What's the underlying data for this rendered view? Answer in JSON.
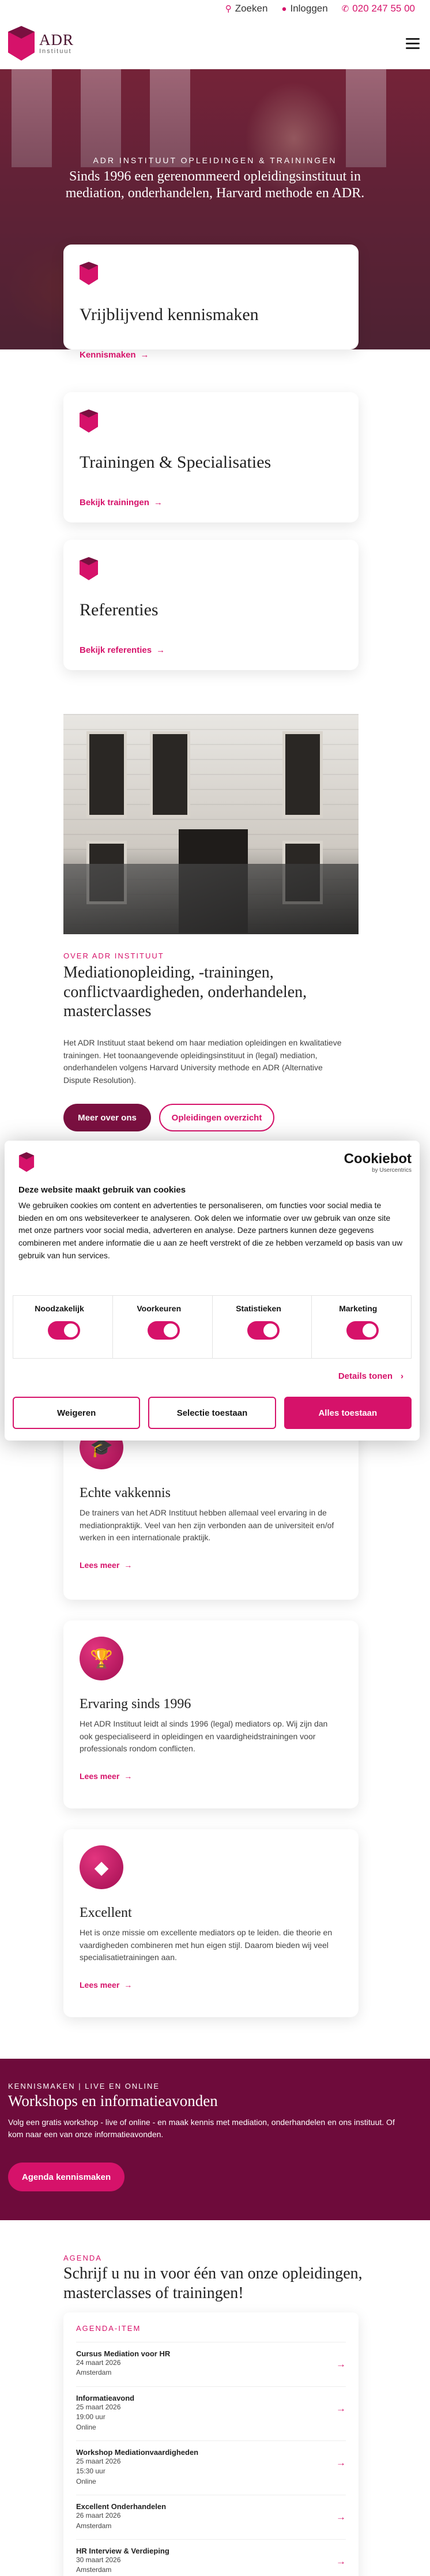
{
  "topbar": {
    "search": "Zoeken",
    "login": "Inloggen",
    "phone": "020 247 55 00"
  },
  "logo": {
    "name": "ADR",
    "sub": "Instituut"
  },
  "hero": {
    "kicker": "ADR INSTITUUT OPLEIDINGEN & TRAININGEN",
    "title": "Sinds 1996 een gerenommeerd opleidingsinstituut in mediation, onderhandelen, Harvard methode en ADR."
  },
  "cards": [
    {
      "title": "Vrijblijvend kennismaken",
      "link": "Kennismaken"
    },
    {
      "title": "Trainingen & Specialisaties",
      "link": "Bekijk trainingen"
    },
    {
      "title": "Referenties",
      "link": "Bekijk referenties"
    }
  ],
  "about": {
    "kicker": "OVER ADR INSTITUUT",
    "title": "Mediationopleiding, -trainingen, conflictvaardigheden, onderhandelen, masterclasses",
    "text": "Het ADR Instituut staat bekend om haar mediation opleidingen en kwalitatieve trainingen. Het toonaangevende opleidingsinstituut in (legal) mediation, onderhandelen volgens Harvard University methode en ADR (Alternative Dispute Resolution).",
    "btn_primary": "Meer over ons",
    "btn_outline": "Opleidingen overzicht"
  },
  "cookie": {
    "brand": "Cookiebot",
    "brand_sub": "by Usercentrics",
    "title": "Deze website maakt gebruik van cookies",
    "text": "We gebruiken cookies om content en advertenties te personaliseren, om functies voor social media te bieden en om ons websiteverkeer te analyseren. Ook delen we informatie over uw gebruik van onze site met onze partners voor social media, adverteren en analyse. Deze partners kunnen deze gegevens combineren met andere informatie die u aan ze heeft verstrekt of die ze hebben verzameld op basis van uw gebruik van hun services.",
    "toggles": [
      "Noodzakelijk",
      "Voorkeuren",
      "Statistieken",
      "Marketing"
    ],
    "details": "Details tonen",
    "btn_deny": "Weigeren",
    "btn_selection": "Selectie toestaan",
    "btn_all": "Alles toestaan"
  },
  "features": [
    {
      "icon": "graduation-cap-icon",
      "title": "Echte vakkennis",
      "text": "De trainers van het ADR Instituut hebben allemaal veel ervaring in de mediationpraktijk. Veel van hen zijn verbonden aan de universiteit en/of werken in een internationale praktijk.",
      "link": "Lees meer"
    },
    {
      "icon": "trophy-icon",
      "title": "Ervaring sinds 1996",
      "text": "Het ADR Instituut leidt al sinds 1996 (legal) mediators op. Wij zijn dan ook gespecialiseerd in opleidingen en vaardigheidstrainingen voor professionals rondom conflicten.",
      "link": "Lees meer"
    },
    {
      "icon": "diamond-icon",
      "title": "Excellent",
      "text": "Het is onze missie om excellente mediators op te leiden. die theorie en vaardigheden combineren met hun eigen stijl. Daarom bieden wij veel specialisatietrainingen aan.",
      "link": "Lees meer"
    }
  ],
  "workshops": {
    "kicker": "KENNISMAKEN | LIVE EN ONLINE",
    "title": "Workshops en informatieavonden",
    "text": "Volg een gratis workshop - live of online - en maak kennis met mediation, onderhandelen en ons instituut. Of kom naar een van onze informatieavonden.",
    "button": "Agenda kennismaken"
  },
  "agenda": {
    "kicker": "AGENDA",
    "title": "Schrijf u nu in voor één van onze opleidingen, masterclasses of trainingen!",
    "list_header": "AGENDA-ITEM",
    "items": [
      {
        "title": "Cursus Mediation voor HR",
        "date": "24 maart 2026",
        "place": "Amsterdam",
        "time": ""
      },
      {
        "title": "Informatieavond",
        "date": "25 maart 2026",
        "time": "19:00 uur",
        "place": "Online"
      },
      {
        "title": "Workshop Mediationvaardigheden",
        "date": "25 maart 2026",
        "time": "15:30 uur",
        "place": "Online"
      },
      {
        "title": "Excellent Onderhandelen",
        "date": "26 maart 2026",
        "place": "Amsterdam",
        "time": ""
      },
      {
        "title": "HR Interview & Verdieping",
        "date": "30 maart 2026",
        "place": "Amsterdam",
        "time": ""
      }
    ]
  },
  "colors": {
    "accent": "#d6126a",
    "dark": "#6e0b3b",
    "button_dark": "#7a1040"
  }
}
